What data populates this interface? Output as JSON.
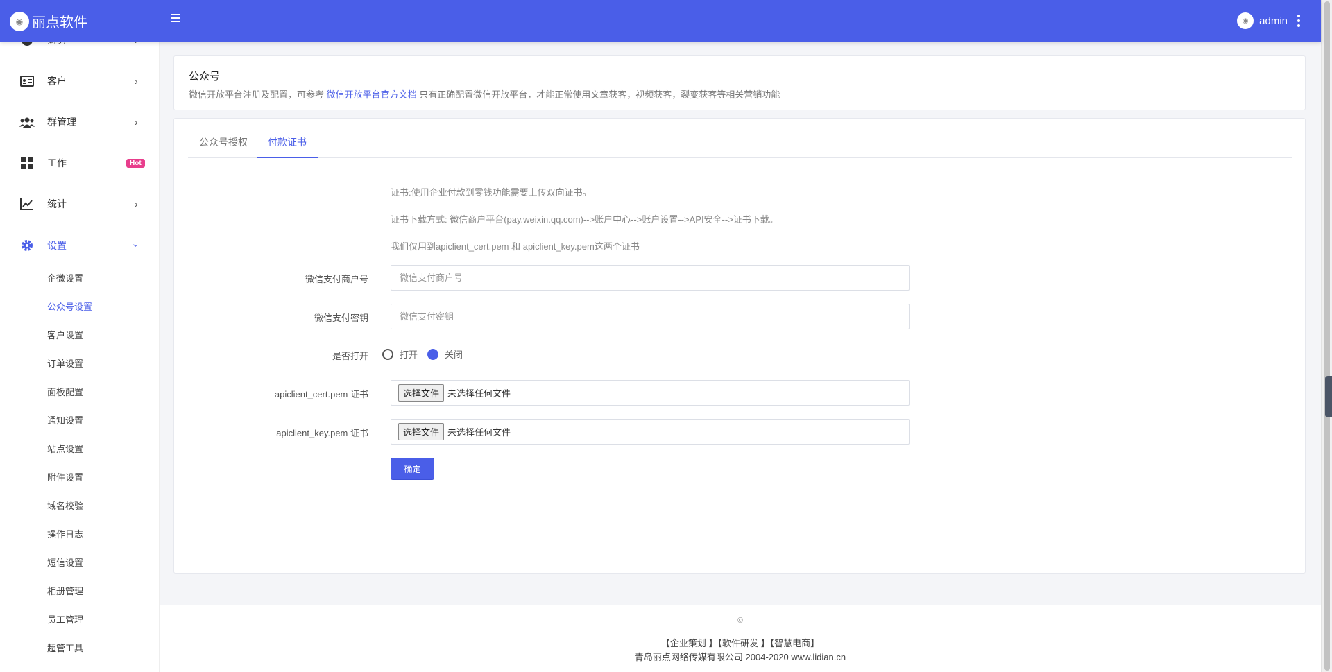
{
  "app": {
    "brand": "丽点软件",
    "user": "admin"
  },
  "sidebar": {
    "items": [
      {
        "label": "财务",
        "icon": "finance-icon"
      },
      {
        "label": "客户",
        "icon": "id-card-icon"
      },
      {
        "label": "群管理",
        "icon": "users-icon"
      },
      {
        "label": "工作",
        "icon": "grid-icon",
        "badge": "Hot"
      },
      {
        "label": "统计",
        "icon": "line-chart-icon"
      },
      {
        "label": "设置",
        "icon": "gear-icon"
      }
    ],
    "sub_items": [
      "企微设置",
      "公众号设置",
      "客户设置",
      "订单设置",
      "面板配置",
      "通知设置",
      "站点设置",
      "附件设置",
      "域名校验",
      "操作日志",
      "短信设置",
      "相册管理",
      "员工管理",
      "超管工具"
    ]
  },
  "header": {
    "title": "公众号",
    "desc_before": "微信开放平台注册及配置，可参考",
    "desc_link": "微信开放平台官方文档",
    "desc_after": "只有正确配置微信开放平台，才能正常使用文章获客，视频获客，裂变获客等相关营销功能"
  },
  "tabs": [
    "公众号授权",
    "付款证书"
  ],
  "notes": [
    "证书:使用企业付款到零钱功能需要上传双向证书。",
    "证书下载方式: 微信商户平台(pay.weixin.qq.com)-->账户中心-->账户设置-->API安全-->证书下载。",
    "我们仅用到apiclient_cert.pem 和 apiclient_key.pem这两个证书"
  ],
  "form": {
    "mch_id": {
      "label": "微信支付商户号",
      "placeholder": "微信支付商户号"
    },
    "secret": {
      "label": "微信支付密钥",
      "placeholder": "微信支付密钥"
    },
    "enable": {
      "label": "是否打开",
      "options": [
        "打开",
        "关闭"
      ],
      "selected": "关闭"
    },
    "cert": {
      "label": "apiclient_cert.pem 证书",
      "button": "选择文件",
      "status": "未选择任何文件"
    },
    "key": {
      "label": "apiclient_key.pem 证书",
      "button": "选择文件",
      "status": "未选择任何文件"
    },
    "submit": "确定"
  },
  "footer": {
    "copy": "©",
    "links": "【企业策划 】【软件研发 】【智慧电商】",
    "company": "青岛丽点网络传媒有限公司 2004-2020 www.lidian.cn"
  },
  "colors": {
    "primary": "#4a5ee8",
    "badge": "#e83e8c"
  }
}
